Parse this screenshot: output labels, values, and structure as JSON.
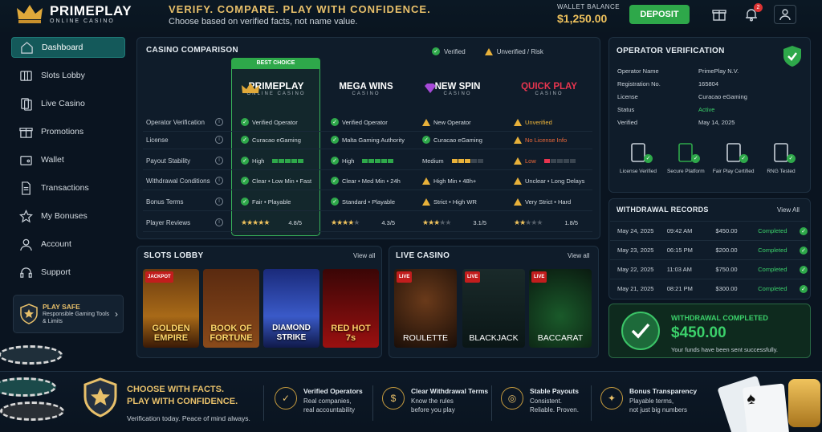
{
  "app": {
    "name": "PRIMEPLAY",
    "sub": "ONLINE CASINO"
  },
  "header": {
    "headline": "VERIFY. COMPARE. PLAY WITH CONFIDENCE.",
    "subline": "Choose based on verified facts, not name value.",
    "wallet_label": "WALLET BALANCE",
    "wallet_value": "$1,250.00",
    "deposit_label": "DEPOSIT",
    "notif_count": "2"
  },
  "sidebar": {
    "items": [
      {
        "label": "Dashboard",
        "icon": "home-icon"
      },
      {
        "label": "Slots Lobby",
        "icon": "slots-icon"
      },
      {
        "label": "Live Casino",
        "icon": "cards-icon"
      },
      {
        "label": "Promotions",
        "icon": "gift-icon"
      },
      {
        "label": "Wallet",
        "icon": "wallet-icon"
      },
      {
        "label": "Transactions",
        "icon": "document-icon"
      },
      {
        "label": "My Bonuses",
        "icon": "star-icon"
      },
      {
        "label": "Account",
        "icon": "user-icon"
      },
      {
        "label": "Support",
        "icon": "headset-icon"
      }
    ],
    "playsafe_title": "PLAY SAFE",
    "playsafe_sub": "Responsible Gaming Tools & Limits"
  },
  "comparison": {
    "title": "CASINO COMPARISON",
    "legend_verified": "Verified",
    "legend_risk": "Unverified / Risk",
    "best_choice": "BEST CHOICE",
    "rows": [
      "Operator Verification",
      "License",
      "Payout Stability",
      "Withdrawal Conditions",
      "Bonus Terms",
      "Player Reviews"
    ],
    "casinos": [
      {
        "name": "PRIMEPLAY",
        "sub": "ONLINE CASINO",
        "color": "#ffffff",
        "verification": "Verified Operator",
        "license": "Curacao eGaming",
        "payout": "High",
        "payout_level": 5,
        "withdrawal": "Clear • Low Min • Fast",
        "bonus": "Fair • Playable",
        "rating": "4.8/5",
        "stars": 5
      },
      {
        "name": "MEGA WINS",
        "sub": "CASINO",
        "color": "#ffffff",
        "verification": "Verified Operator",
        "license": "Malta Gaming Authority",
        "payout": "High",
        "payout_level": 5,
        "withdrawal": "Clear • Med Min • 24h",
        "bonus": "Standard • Playable",
        "rating": "4.3/5",
        "stars": 4
      },
      {
        "name": "NEW SPIN",
        "sub": "CASINO",
        "color": "#ffffff",
        "verification": "New Operator",
        "license": "Curacao eGaming",
        "payout": "Medium",
        "payout_level": 3,
        "withdrawal": "High Min • 48h+",
        "bonus": "Strict • High WR",
        "rating": "3.1/5",
        "stars": 3
      },
      {
        "name": "QUICK PLAY",
        "sub": "CASINO",
        "color": "#e8354f",
        "verification": "Unverified",
        "license": "No License Info",
        "payout": "Low",
        "payout_level": 1,
        "withdrawal": "Unclear • Long Delays",
        "bonus": "Very Strict • Hard",
        "rating": "1.8/5",
        "stars": 2
      }
    ]
  },
  "slots": {
    "title": "SLOTS LOBBY",
    "view_all": "View all",
    "tiles": [
      {
        "title": "GOLDEN EMPIRE",
        "badge": "JACKPOT"
      },
      {
        "title": "BOOK OF FORTUNE",
        "badge": ""
      },
      {
        "title": "DIAMOND STRIKE",
        "badge": ""
      },
      {
        "title": "RED HOT 7s",
        "badge": ""
      }
    ]
  },
  "live": {
    "title": "LIVE CASINO",
    "view_all": "View all",
    "tiles": [
      {
        "title": "ROULETTE",
        "badge": "LIVE"
      },
      {
        "title": "BLACKJACK",
        "badge": "LIVE"
      },
      {
        "title": "BACCARAT",
        "badge": "LIVE"
      }
    ]
  },
  "operator": {
    "title": "OPERATOR VERIFICATION",
    "fields": [
      {
        "k": "Operator Name",
        "v": "PrimePlay N.V."
      },
      {
        "k": "Registration No.",
        "v": "165804"
      },
      {
        "k": "License",
        "v": "Curacao eGaming"
      },
      {
        "k": "Status",
        "v": "Active"
      },
      {
        "k": "Verified",
        "v": "May 14, 2025"
      }
    ],
    "badges": [
      "License Verified",
      "Secure Platform",
      "Fair Play Certified",
      "RNG Tested"
    ]
  },
  "withdrawals": {
    "title": "WITHDRAWAL RECORDS",
    "view_all": "View All",
    "rows": [
      {
        "date": "May 24, 2025",
        "time": "09:42 AM",
        "amount": "$450.00",
        "status": "Completed"
      },
      {
        "date": "May 23, 2025",
        "time": "06:15 PM",
        "amount": "$200.00",
        "status": "Completed"
      },
      {
        "date": "May 22, 2025",
        "time": "11:03 AM",
        "amount": "$750.00",
        "status": "Completed"
      },
      {
        "date": "May 21, 2025",
        "time": "08:21 PM",
        "amount": "$300.00",
        "status": "Completed"
      }
    ]
  },
  "completed": {
    "title": "WITHDRAWAL COMPLETED",
    "amount": "$450.00",
    "sub": "Your funds have been sent successfully."
  },
  "footer": {
    "title1": "CHOOSE WITH FACTS.",
    "title2": "PLAY WITH CONFIDENCE.",
    "sub": "Verification today. Peace of mind always.",
    "features": [
      {
        "t": "Verified Operators",
        "d1": "Real companies,",
        "d2": "real accountability"
      },
      {
        "t": "Clear Withdrawal Terms",
        "d1": "Know the rules",
        "d2": "before you play"
      },
      {
        "t": "Stable Payouts",
        "d1": "Consistent.",
        "d2": "Reliable. Proven."
      },
      {
        "t": "Bonus Transparency",
        "d1": "Playable terms,",
        "d2": "not just big numbers"
      }
    ]
  },
  "colors": {
    "accent": "#2ea84a",
    "gold": "#e8c06a",
    "danger": "#e8354f"
  }
}
